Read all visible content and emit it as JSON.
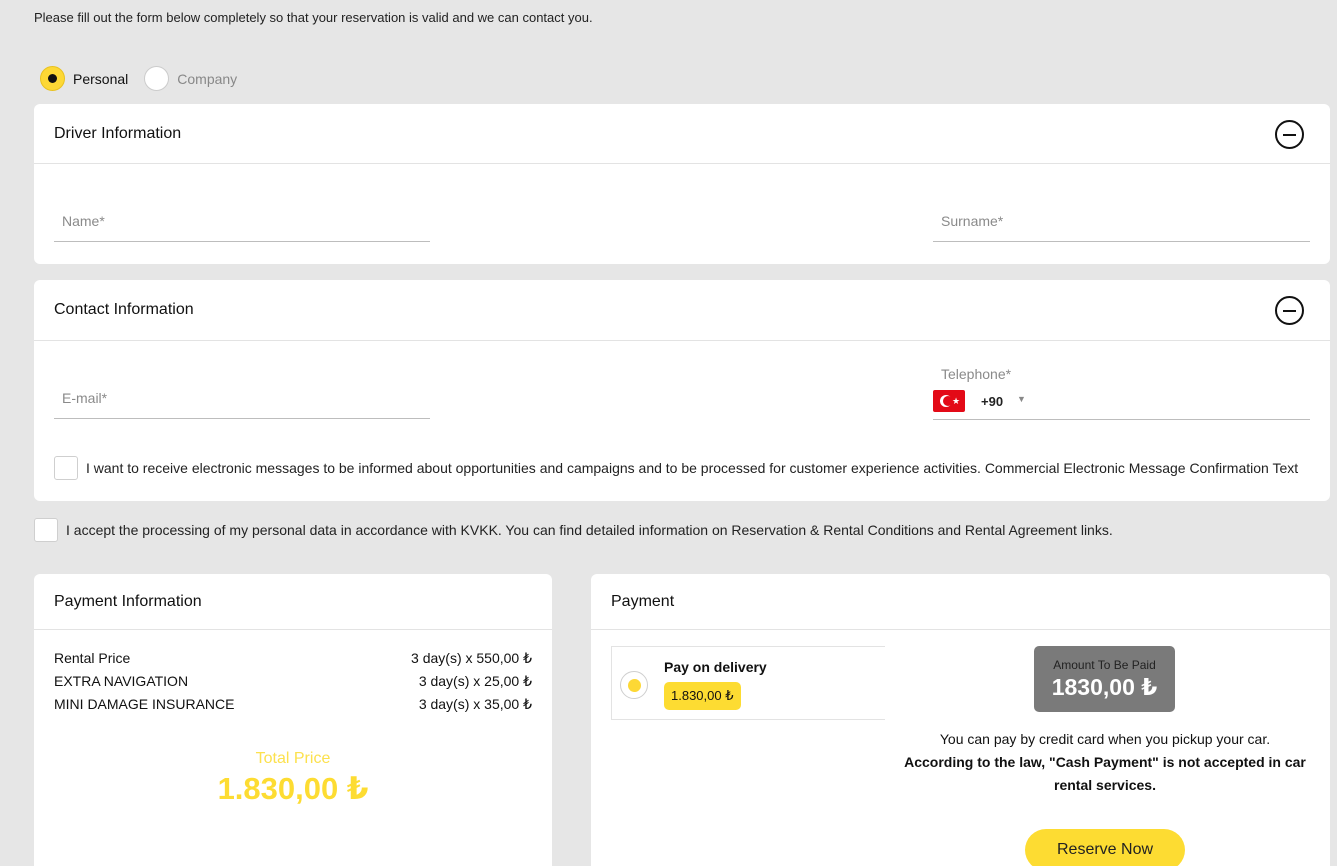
{
  "intro": "Please fill out the form below completely so that your reservation is valid and we can contact you.",
  "customer_type": {
    "personal": "Personal",
    "company": "Company",
    "selected": "personal"
  },
  "driver": {
    "title": "Driver Information",
    "name_placeholder": "Name*",
    "surname_placeholder": "Surname*"
  },
  "contact": {
    "title": "Contact Information",
    "email_placeholder": "E-mail*",
    "telephone_label": "Telephone*",
    "country_code": "+90",
    "consent_text": "I want to receive electronic messages to be informed about opportunities and campaigns and to be processed for customer experience activities.  Commercial Electronic Message Confirmation Text"
  },
  "kvkk_text": "I accept the processing of my personal data in accordance with KVKK. You can find detailed information on Reservation & Rental Conditions and Rental Agreement links.",
  "payment_info": {
    "title": "Payment Information",
    "rows": [
      {
        "label": "Rental Price",
        "value": "3 day(s) x 550,00 ₺"
      },
      {
        "label": "EXTRA NAVIGATION",
        "value": "3 day(s) x 25,00 ₺"
      },
      {
        "label": "MINI DAMAGE INSURANCE",
        "value": "3 day(s) x 35,00 ₺"
      }
    ],
    "total_label": "Total Price",
    "total_value": "1.830,00 ₺"
  },
  "payment": {
    "title": "Payment",
    "option_title": "Pay on delivery",
    "option_amount": "1.830,00 ₺",
    "amount_label": "Amount To Be Paid",
    "amount_value": "1830,00 ₺",
    "note": "You can pay by credit card when you pickup your car.",
    "law_note": "According to the law, \"Cash Payment\" is not accepted in car rental services.",
    "reserve_label": "Reserve Now"
  },
  "colors": {
    "accent": "#fddc32",
    "background": "#e6e6e6"
  }
}
